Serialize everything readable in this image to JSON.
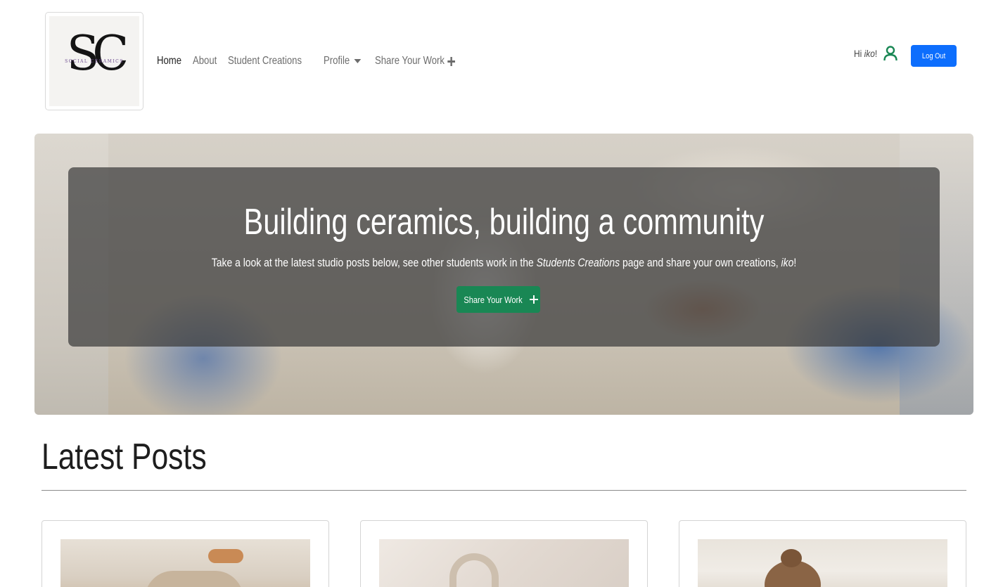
{
  "brand": {
    "monogram": "SC",
    "logo_text": "SOCIAL CERAMICS"
  },
  "nav": {
    "items": [
      {
        "label": "Home",
        "active": true
      },
      {
        "label": "About"
      },
      {
        "label": "Student Creations"
      },
      {
        "label": "Profile",
        "has_dropdown": true
      },
      {
        "label": "Share Your Work",
        "icon": "plus-icon"
      }
    ]
  },
  "user": {
    "greeting_prefix": "Hi",
    "username": "iko",
    "greeting_suffix": "!",
    "icon": "user-icon",
    "logout_label": "Log Out"
  },
  "hero": {
    "title": "Building ceramics, building a community",
    "subtitle_part1": "Take a look at the latest studio posts below, see other students work in the ",
    "subtitle_link": "Students Creations",
    "subtitle_part2": " page and share your own creations, ",
    "subtitle_user": "iko",
    "subtitle_end": "!",
    "button_label": "Share Your Work",
    "button_icon": "plus-icon"
  },
  "posts": {
    "title": "Latest Posts"
  },
  "colors": {
    "primary": "#0d6efd",
    "success": "#198754",
    "user_icon": "#198754"
  }
}
